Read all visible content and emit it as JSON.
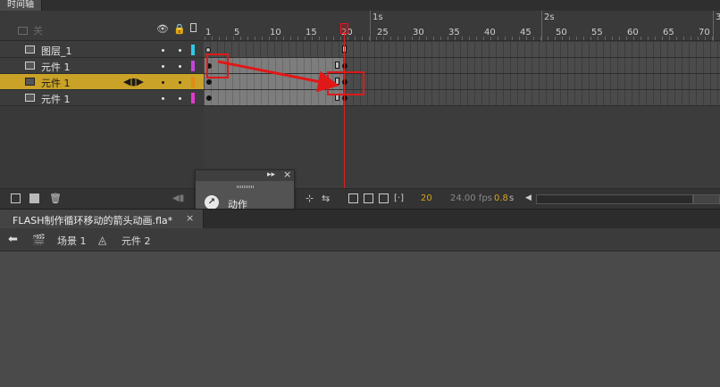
{
  "panel": {
    "tab": "时间轴"
  },
  "layers_header": {
    "disabled_layer": "关"
  },
  "column_icons": {
    "eye": "eye-icon",
    "lock": "lock-icon",
    "outline": "outline-icon"
  },
  "ruler": {
    "frame_numbers": [
      "1",
      "5",
      "10",
      "15",
      "20",
      "25",
      "30",
      "35",
      "40",
      "45",
      "50",
      "55",
      "60",
      "65",
      "70"
    ],
    "second_labels": [
      "1s",
      "2s",
      "3"
    ]
  },
  "layers": [
    {
      "name": "图层_1",
      "color": "#2ec9e6",
      "selected": false
    },
    {
      "name": "元件 1",
      "color": "#c445d9",
      "selected": false
    },
    {
      "name": "元件 1",
      "color": "#e08a18",
      "selected": true
    },
    {
      "name": "元件 1",
      "color": "#e03ad0",
      "selected": false
    }
  ],
  "footer": {
    "current_frame": "20",
    "fps": "24.00 fps",
    "time": "0.8",
    "time_unit": "s"
  },
  "actions_panel": {
    "label": "动作",
    "controls": "▸▸"
  },
  "document": {
    "title": "FLASH制作循环移动的箭头动画.fla*",
    "close": "×"
  },
  "breadcrumb": {
    "scene": "场景 1",
    "symbol": "元件 2"
  },
  "colors": {
    "selection": "#c9a227",
    "playhead": "#e02020",
    "annotation": "#e01818"
  }
}
